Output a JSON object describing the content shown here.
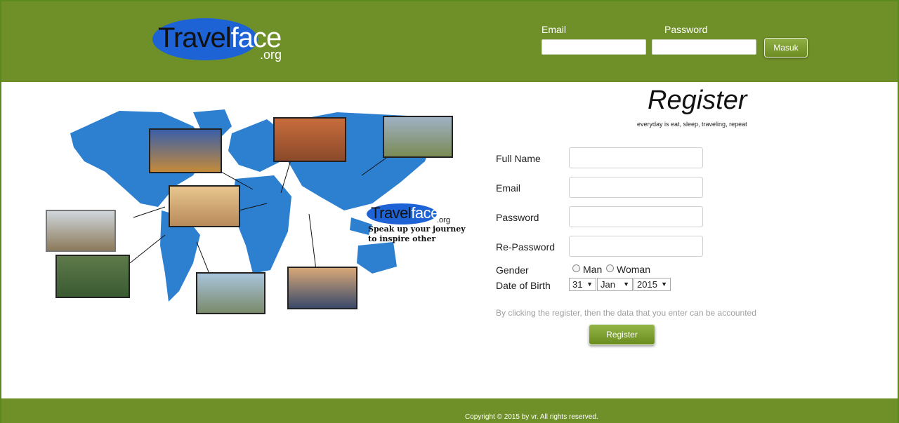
{
  "header": {
    "logo_main": "Travel",
    "logo_accent": "face",
    "logo_suffix": ".org",
    "email_label": "Email",
    "password_label": "Password",
    "login_button": "Masuk"
  },
  "promo": {
    "logo_main": "Travel",
    "logo_accent": "face",
    "logo_suffix": ".org",
    "tagline_line1": "Speak up your journey",
    "tagline_line2": "to inspire other"
  },
  "register": {
    "title": "Register",
    "subtitle": "everyday is eat, sleep, traveling, repeat",
    "full_name_label": "Full Name",
    "email_label": "Email",
    "password_label": "Password",
    "repassword_label": "Re-Password",
    "gender_label": "Gender",
    "gender_man": "Man",
    "gender_woman": "Woman",
    "dob_label": "Date of Birth",
    "dob_day": "31",
    "dob_month": "Jan",
    "dob_year": "2015",
    "note": "By clicking the register, then the data that you enter can be accounted",
    "submit": "Register"
  },
  "footer": {
    "copyright": "Copyright © 2015 by vr.  All rights reserved."
  },
  "colors": {
    "brand_green": "#6f8f28",
    "logo_blue": "#1d63d6",
    "map_blue": "#2d7fd0"
  }
}
